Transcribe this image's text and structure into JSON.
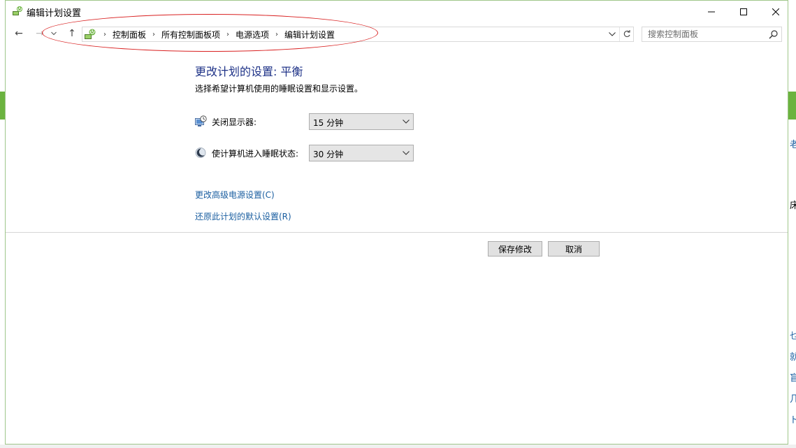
{
  "window": {
    "title": "编辑计划设置"
  },
  "nav": {
    "back": "←",
    "forward": "→",
    "up": "↑"
  },
  "address": {
    "crumbs": [
      "控制面板",
      "所有控制面板项",
      "电源选项",
      "编辑计划设置"
    ]
  },
  "search": {
    "placeholder": "搜索控制面板"
  },
  "page": {
    "title": "更改计划的设置: 平衡",
    "subtitle": "选择希望计算机使用的睡眠设置和显示设置。"
  },
  "settings": {
    "display": {
      "label": "关闭显示器:",
      "value": "15 分钟"
    },
    "sleep": {
      "label": "使计算机进入睡眠状态:",
      "value": "30 分钟"
    }
  },
  "links": {
    "advanced": "更改高级电源设置(C)",
    "restore": "还原此计划的默认设置(R)"
  },
  "buttons": {
    "save": "保存修改",
    "cancel": "取消"
  },
  "background": {
    "snippets": [
      "老",
      "床",
      "乜",
      "就",
      "盲",
      "几",
      "ト"
    ]
  },
  "colors": {
    "title_blue": "#1e3287",
    "link_blue": "#1a5ea0",
    "annotation_red": "#d92020",
    "accent_green": "#6bb33f"
  }
}
